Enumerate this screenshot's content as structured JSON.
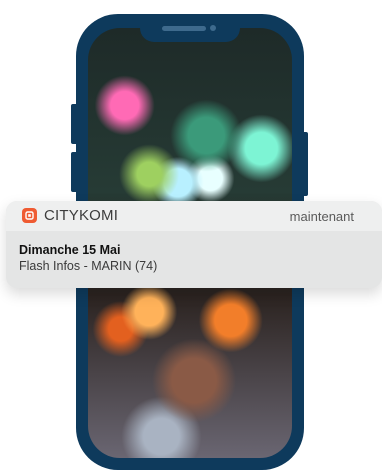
{
  "notification": {
    "app_name": "CITYKOMI",
    "time": "maintenant",
    "title": "Dimanche 15 Mai",
    "body": "Flash Infos - MARIN (74)",
    "app_icon": "citykomi-logo-icon",
    "accent_color": "#ef5b32"
  },
  "device": {
    "frame_color": "#0e3a5c"
  }
}
